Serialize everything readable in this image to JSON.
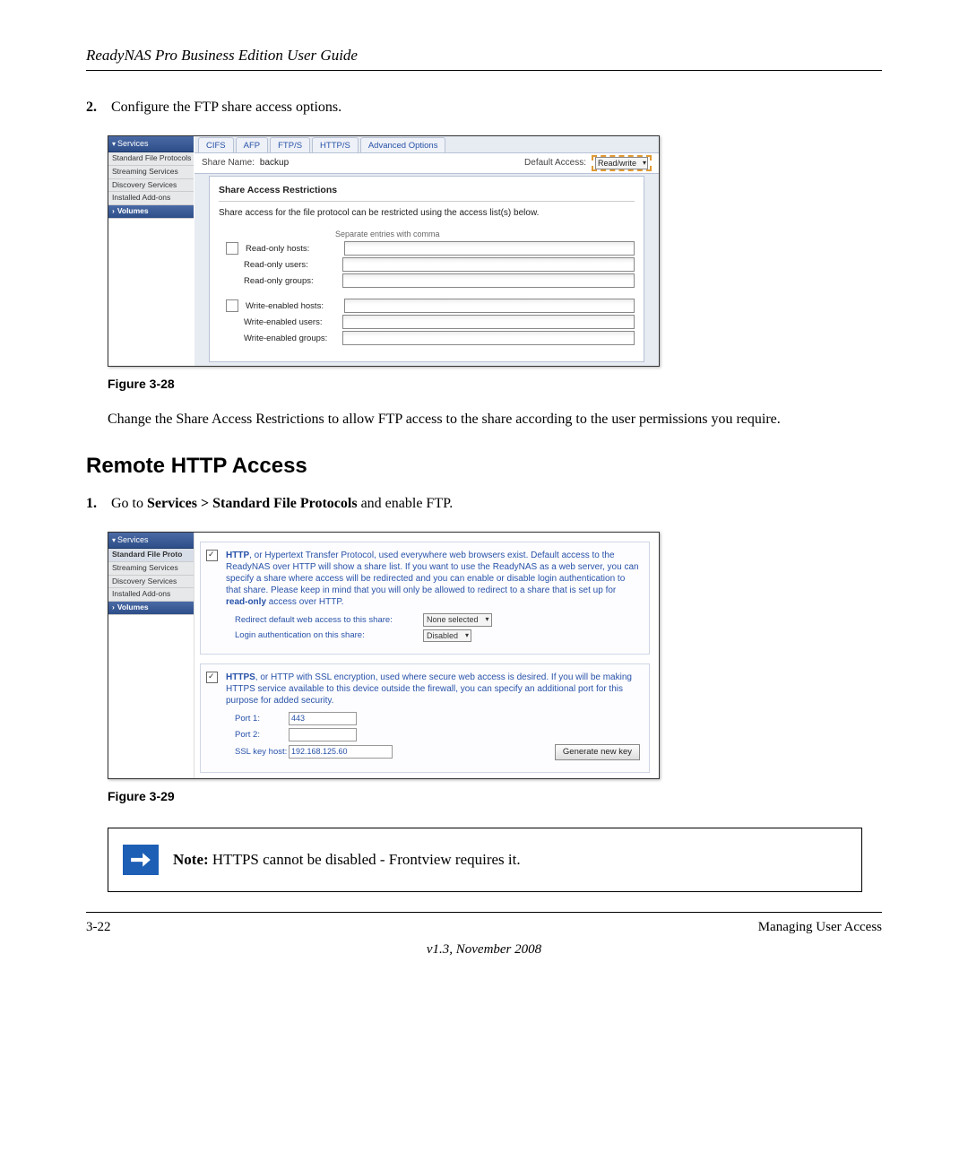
{
  "header": {
    "title": "ReadyNAS Pro Business Edition User Guide"
  },
  "step2": {
    "num": "2.",
    "text": "Configure the FTP share access options."
  },
  "fig28": {
    "caption": "Figure 3-28",
    "nav": {
      "header": "Services",
      "items": [
        "Standard File Protocols",
        "Streaming Services",
        "Discovery Services",
        "Installed Add-ons"
      ],
      "volumes": "Volumes"
    },
    "tabs": [
      "CIFS",
      "AFP",
      "FTP/S",
      "HTTP/S",
      "Advanced Options"
    ],
    "share": {
      "label": "Share Name:",
      "value": "backup",
      "default_label": "Default Access:",
      "default_value": "Read/write"
    },
    "panel": {
      "title": "Share Access Restrictions",
      "desc": "Share access for the file protocol can be restricted using the access list(s) below.",
      "hint": "Separate entries with comma",
      "ro": [
        "Read-only hosts:",
        "Read-only users:",
        "Read-only groups:"
      ],
      "rw": [
        "Write-enabled hosts:",
        "Write-enabled users:",
        "Write-enabled groups:"
      ]
    }
  },
  "para_after28": "Change the Share Access Restrictions to allow FTP access to the share according to the user permissions you require.",
  "h2": "Remote HTTP Access",
  "step1b": {
    "num": "1.",
    "prefix": "Go to ",
    "bold": "Services > Standard File Protocols",
    "suffix": " and enable FTP."
  },
  "fig29": {
    "caption": "Figure 3-29",
    "nav": {
      "header": "Services",
      "items": [
        "Standard File Proto",
        "Streaming Services",
        "Discovery Services",
        "Installed Add-ons"
      ],
      "volumes": "Volumes"
    },
    "http": {
      "bold": "HTTP",
      "text": ", or Hypertext Transfer Protocol, used everywhere web browsers exist. Default access to the ReadyNAS over HTTP will show a share list. If you want to use the ReadyNAS as a web server, you can specify a share where access will be redirected and you can enable or disable login authentication to that share. Please keep in mind that you will only be allowed to redirect to a share that is set up for ",
      "bold2": "read-only",
      "text2": " access over HTTP.",
      "redirect_label": "Redirect default web access to this share:",
      "redirect_value": "None selected",
      "login_label": "Login authentication on this share:",
      "login_value": "Disabled"
    },
    "https": {
      "bold": "HTTPS",
      "text": ", or HTTP with SSL encryption, used where secure web access is desired. If you will be making HTTPS service available to this device outside the firewall, you can specify an additional port for this purpose for added security.",
      "port1_label": "Port 1:",
      "port1_value": "443",
      "port2_label": "Port 2:",
      "port2_value": "",
      "ssl_label": "SSL key host:",
      "ssl_value": "192.168.125.60",
      "button": "Generate new key"
    }
  },
  "note": {
    "bold": "Note:",
    "text": " HTTPS cannot be disabled - Frontview requires it."
  },
  "footer": {
    "left": "3-22",
    "right": "Managing User Access",
    "center": "v1.3, November 2008"
  }
}
